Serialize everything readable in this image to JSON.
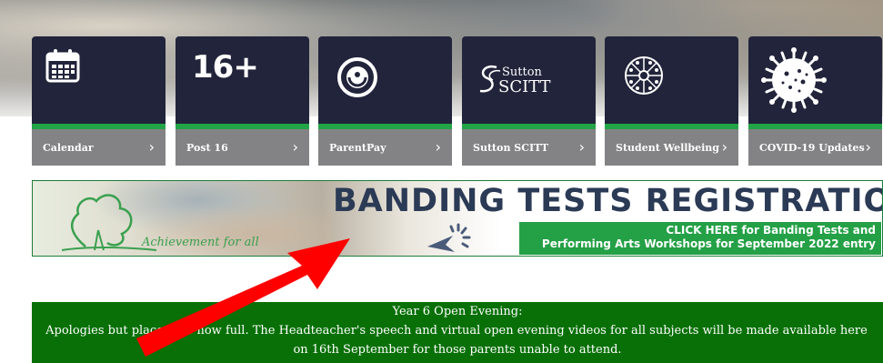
{
  "tiles": [
    {
      "label": "Calendar",
      "icon": "calendar-icon"
    },
    {
      "label": "Post 16",
      "icon": "post16-logo",
      "icon_text": "16+"
    },
    {
      "label": "ParentPay",
      "icon": "parentpay-logo"
    },
    {
      "label": "Sutton SCITT",
      "icon": "sutton-scitt-logo",
      "icon_text_1": "Sutton",
      "icon_text_2": "SCITT"
    },
    {
      "label": "Student Wellbeing",
      "icon": "wellbeing-icon"
    },
    {
      "label": "COVID-19 Updates",
      "icon": "virus-icon"
    }
  ],
  "chevron": "›",
  "banner": {
    "title": "BANDING TESTS REGISTRATIONS",
    "cta_line1": "CLICK HERE for Banding Tests and",
    "cta_line2": "Performing Arts Workshops for September 2022 entry",
    "tagline": "Achievement for all"
  },
  "notice": {
    "heading": "Year 6 Open Evening:",
    "line1": "Apologies but places are now full. The Headteacher's speech and virtual open evening videos for all subjects will be made available here",
    "line2": "on 16th September for those parents unable to attend."
  },
  "colors": {
    "tile_dark": "#21243a",
    "tile_accent": "#22a447",
    "tile_label_bg": "#838385",
    "notice_bg": "#087007",
    "banner_title": "#2b3a55",
    "annotation_arrow": "#ff0000"
  }
}
